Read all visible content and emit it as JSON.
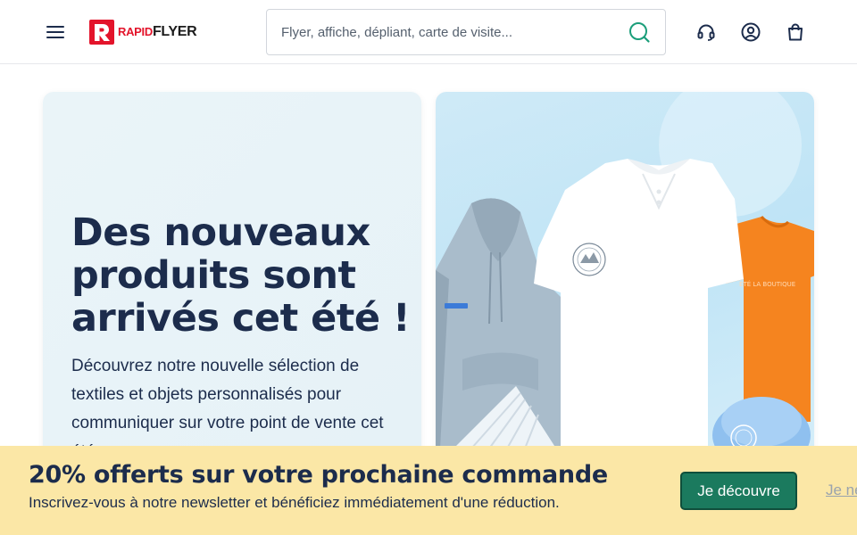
{
  "header": {
    "logo": {
      "text_rapid": "RAPID",
      "text_flyer": "FLYER"
    },
    "search": {
      "placeholder": "Flyer, affiche, dépliant, carte de visite..."
    },
    "icons": [
      "menu-icon",
      "search-icon",
      "headset-icon",
      "account-icon",
      "bag-icon"
    ]
  },
  "hero": {
    "title": "Des nouveaux produits sont arrivés cet été !",
    "description": "Découvrez notre nouvelle sélection de textiles et objets personnalisés pour communiquer sur votre point de vente cet été."
  },
  "banner": {
    "title": "20% offerts sur votre prochaine commande",
    "text": "Inscrivez-vous à notre newsletter et bénéficiez immédiatement d'une réduction.",
    "cta_label": "Je découvre",
    "dismiss_label": "Je ne"
  },
  "colors": {
    "brand_red": "#e3142b",
    "navy": "#1c2c4c",
    "banner_bg": "#fbe7a6",
    "cta_green": "#1b7a5e",
    "hero_bg": "#eaf4f8"
  }
}
